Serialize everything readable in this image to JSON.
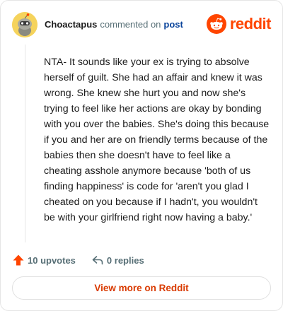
{
  "header": {
    "username": "Choactapus",
    "action_text": "commented on",
    "post_link": "post",
    "logo_wordmark": "reddit"
  },
  "comment": {
    "body": "NTA- It sounds like your ex is trying to absolve herself of guilt. She had an affair and knew it was wrong. She knew she hurt you and now she's trying to feel like her actions are okay by bonding with you over the babies. She's doing this because if you and her are on friendly terms because of the babies then she doesn't have to feel like a cheating asshole anymore because 'both of us finding happiness' is code for 'aren't you glad I cheated on you because if I hadn't, you wouldn't be with your girlfriend right now having a baby.'"
  },
  "actions": {
    "upvotes_label": "10 upvotes",
    "replies_label": "0 replies"
  },
  "footer": {
    "view_more_label": "View more on Reddit"
  },
  "icons": {
    "avatar": "snoo-avatar-icon",
    "logo": "reddit-logo-icon",
    "upvote": "upvote-arrow-icon",
    "reply": "reply-arrow-icon"
  },
  "colors": {
    "brand": "#ff4500",
    "upvote": "#ff4500",
    "link": "#0a449b",
    "muted": "#576f76",
    "view_more": "#d93a00",
    "avatar_bg": "#f5d35c"
  }
}
